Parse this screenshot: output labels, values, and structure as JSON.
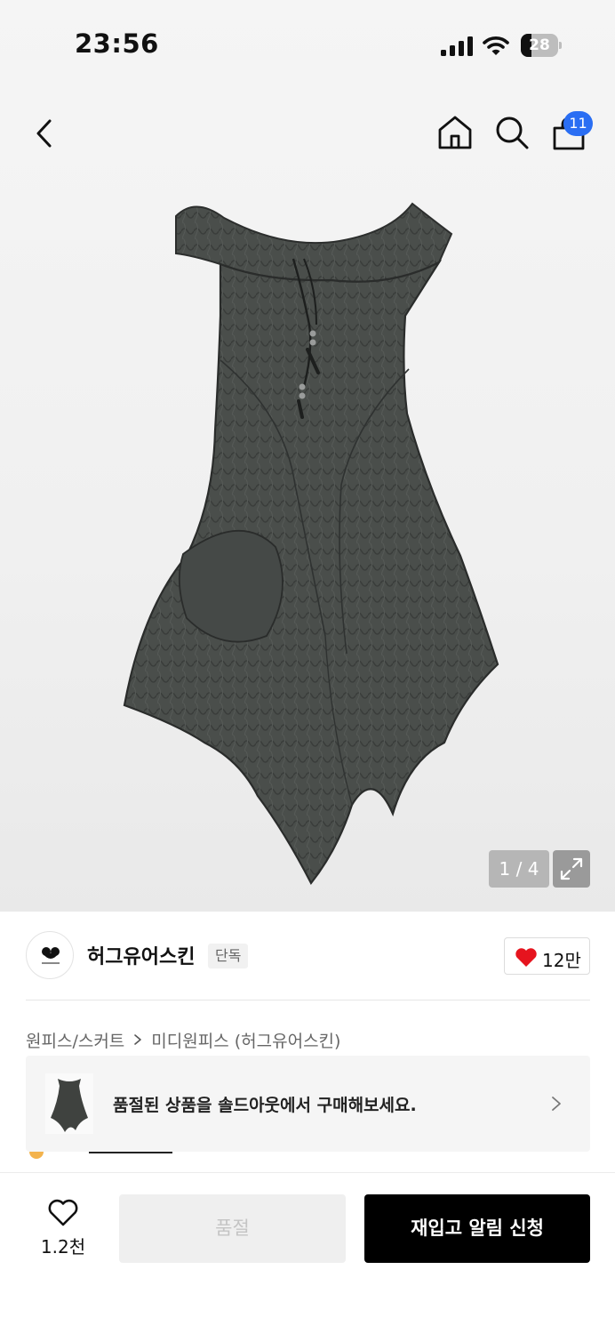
{
  "status_bar": {
    "time": "23:56",
    "battery": "28",
    "battery_level": 0.28,
    "icons": [
      "signal-icon",
      "wifi-icon",
      "battery-icon"
    ]
  },
  "header": {
    "icons": [
      "back-arrow-icon",
      "home-icon",
      "search-icon",
      "cart-icon"
    ],
    "cart_count": "11",
    "badge_color": "#2a6ef3"
  },
  "gallery": {
    "pager": "1 / 4",
    "expand_icon": "expand-icon"
  },
  "brand": {
    "name": "허그유어스킨",
    "tag": "단독",
    "likes": "12만",
    "heart_color": "#e6141e"
  },
  "breadcrumb": {
    "category": "원피스/스커트",
    "subcategory": "미디원피스 (허그유어스킨)"
  },
  "soldout_banner": {
    "text": "품절된 상품을 솔드아웃에서 구매해보세요."
  },
  "bottom_bar": {
    "wish_count": "1.2천",
    "soldout_label": "품절",
    "restock_label": "재입고 알림 신청"
  }
}
